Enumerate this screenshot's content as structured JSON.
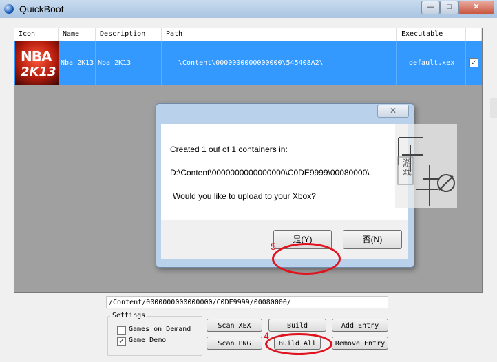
{
  "window": {
    "title": "QuickBoot",
    "controls": [
      "—",
      "□",
      "✕"
    ]
  },
  "list": {
    "columns": [
      "Icon",
      "Name",
      "Description",
      "Path",
      "Executable"
    ],
    "rows": [
      {
        "icon": "nba-2k13-cover-icon",
        "icon_line1": "NBA",
        "icon_line2": "2K13",
        "name": "Nba 2K13",
        "description": "Nba 2K13",
        "path": "\\Content\\0000000000000000\\545408A2\\",
        "executable": "default.xex",
        "checked": true
      }
    ]
  },
  "path_field": {
    "value": "/Content/0000000000000000/C0DE9999/00080000/"
  },
  "settings": {
    "legend": "Settings",
    "options": [
      {
        "label": "Games on Demand",
        "checked": false
      },
      {
        "label": "Game Demo",
        "checked": true
      }
    ]
  },
  "buttons": {
    "scan_xex": "Scan XEX",
    "build": "Build",
    "add_entry": "Add Entry",
    "scan_png": "Scan PNG",
    "build_all": "Build All",
    "remove_entry": "Remove Entry"
  },
  "dialog": {
    "line1": "Created 1 ouf of 1 containers in:",
    "line2": "D:\\Content\\0000000000000000\\C0DE9999\\00080000\\",
    "line3": "Would you like to upload to your Xbox?",
    "yes": "是(Y)",
    "no": "否(N)",
    "close": "✕"
  },
  "annotations": {
    "step_yes": "5",
    "step_build_all": "4"
  },
  "watermark": {
    "text": "游戏"
  },
  "colors": {
    "selection": "#3399ff",
    "annotation": "#e0141e"
  }
}
